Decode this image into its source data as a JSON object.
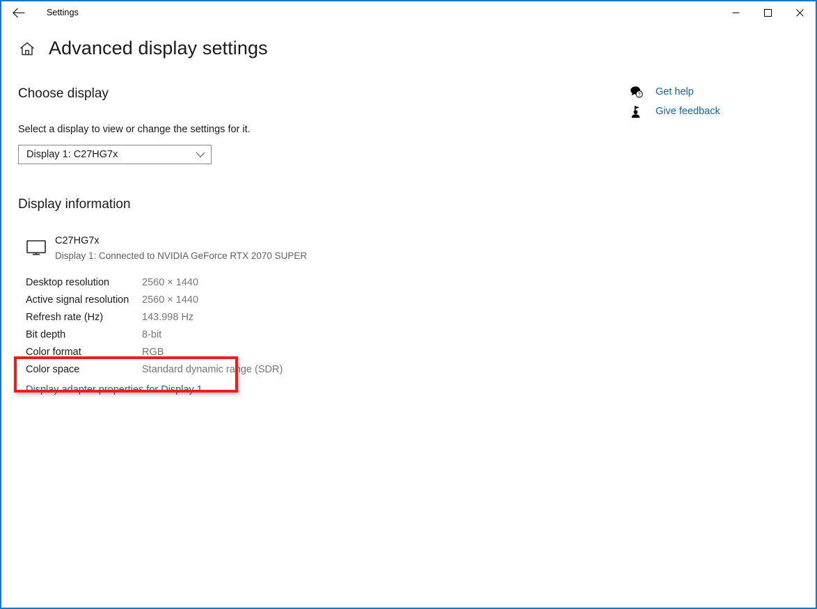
{
  "window": {
    "titlebar_label": "Settings",
    "back_icon": "back-arrow-icon",
    "minimize_label": "─",
    "maximize_label": "□",
    "close_label": "✕",
    "border_color": "#1579c8"
  },
  "header": {
    "home_icon": "home-icon",
    "title": "Advanced display settings"
  },
  "choose_display": {
    "heading": "Choose display",
    "description": "Select a display to view or change the settings for it.",
    "dropdown": {
      "name": "display-select",
      "value": "Display 1: C27HG7x",
      "chevron_icon": "chevron-down-icon"
    }
  },
  "display_information": {
    "heading": "Display information",
    "device": {
      "icon": "monitor-icon",
      "name": "C27HG7x",
      "connection": "Display 1: Connected to NVIDIA GeForce RTX 2070 SUPER"
    },
    "rows": [
      {
        "label": "Desktop resolution",
        "value": "2560 × 1440"
      },
      {
        "label": "Active signal resolution",
        "value": "2560 × 1440"
      },
      {
        "label": "Refresh rate (Hz)",
        "value": "143.998 Hz"
      },
      {
        "label": "Bit depth",
        "value": "8-bit"
      },
      {
        "label": "Color format",
        "value": "RGB"
      },
      {
        "label": "Color space",
        "value": "Standard dynamic range (SDR)"
      }
    ],
    "adapter_link": "Display adapter properties for Display 1",
    "link_color": "#0067c0"
  },
  "annotation": {
    "shape": "rectangle-highlight",
    "color": "#ee1c1c",
    "target": "Display adapter properties for Display 1"
  },
  "side_links": [
    {
      "icon": "help-question-bubble-icon",
      "label": "Get help"
    },
    {
      "icon": "feedback-person-icon",
      "label": "Give feedback"
    }
  ]
}
